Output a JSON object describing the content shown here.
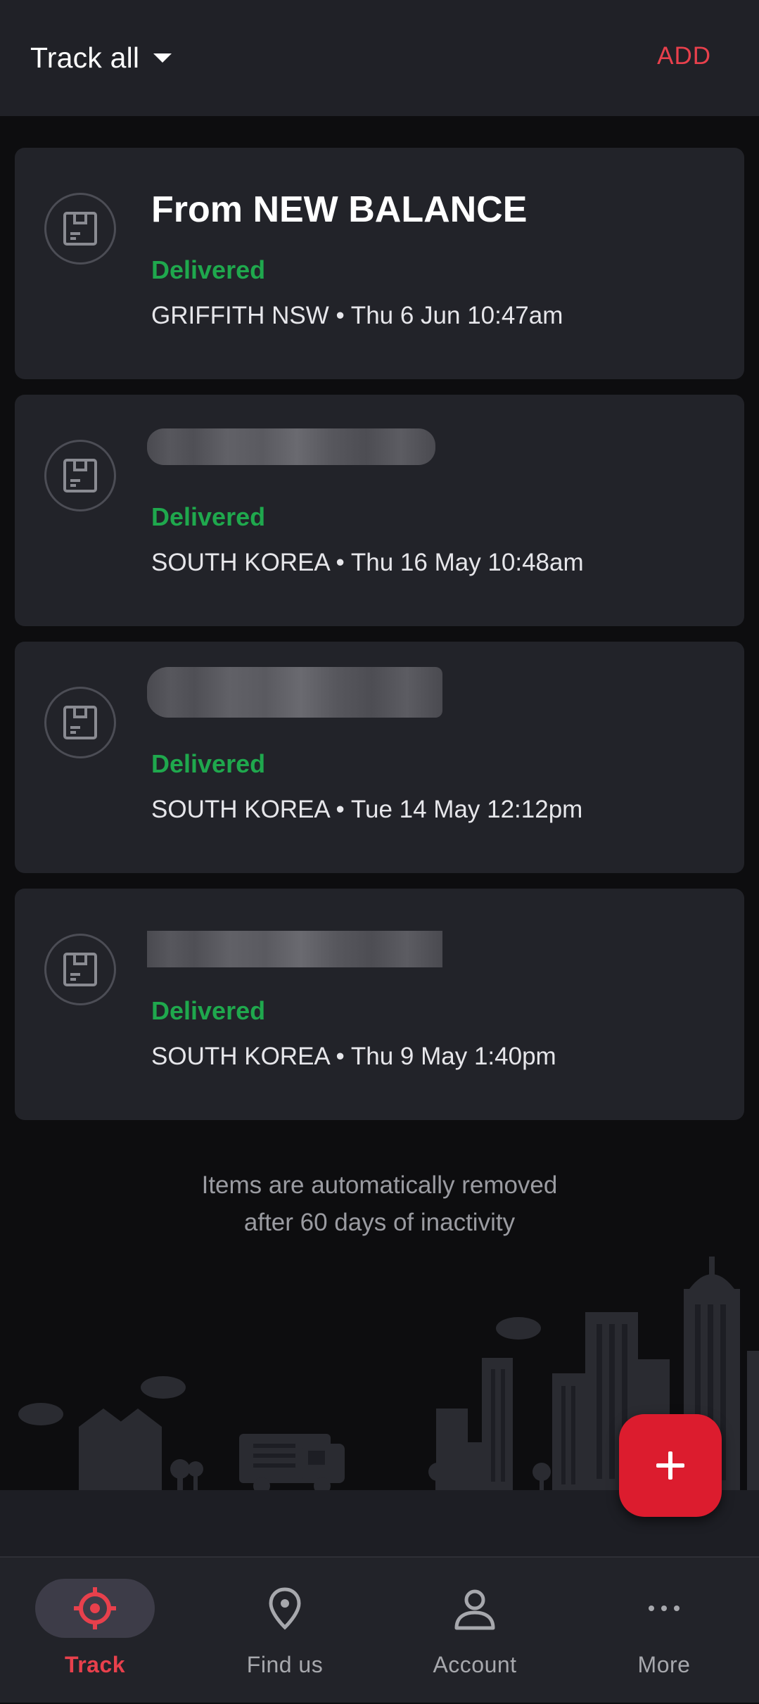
{
  "header": {
    "filter_label": "Track all",
    "add_label": "ADD"
  },
  "colors": {
    "accent": "#e8404c",
    "delivered": "#1fa84d",
    "fab": "#dc1c2e",
    "background": "#0d0d0f",
    "card": "#222329"
  },
  "items": [
    {
      "title": "From NEW BALANCE",
      "status": "Delivered",
      "meta": "GRIFFITH NSW • Thu 6 Jun 10:47am",
      "icon": "package-icon"
    },
    {
      "title": "",
      "status": "Delivered",
      "meta": "SOUTH KOREA • Thu 16 May 10:48am",
      "icon": "package-icon"
    },
    {
      "title": "",
      "status": "Delivered",
      "meta": "SOUTH KOREA • Tue 14 May 12:12pm",
      "icon": "package-icon"
    },
    {
      "title": "",
      "status": "Delivered",
      "meta": "SOUTH KOREA • Thu 9 May 1:40pm",
      "icon": "package-icon"
    }
  ],
  "notice": {
    "line1": "Items are automatically removed",
    "line2": "after 60 days of inactivity"
  },
  "fab": {
    "icon": "plus-icon"
  },
  "nav": [
    {
      "label": "Track",
      "icon": "target-icon",
      "active": true
    },
    {
      "label": "Find us",
      "icon": "location-pin-icon",
      "active": false
    },
    {
      "label": "Account",
      "icon": "person-icon",
      "active": false
    },
    {
      "label": "More",
      "icon": "more-dots-icon",
      "active": false
    }
  ]
}
